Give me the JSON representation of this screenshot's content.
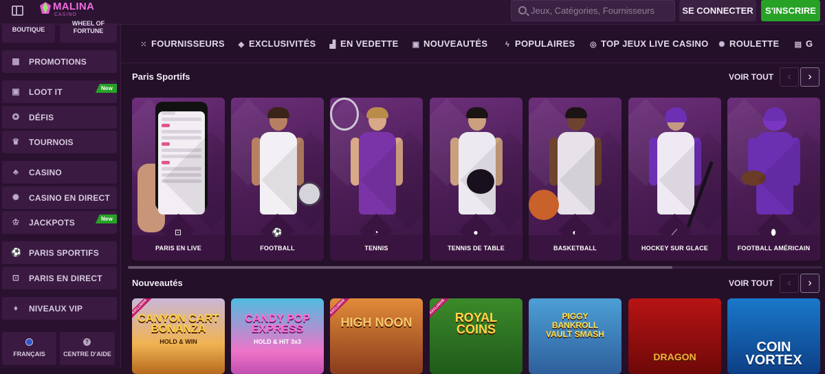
{
  "header": {
    "logo_text": "MALINA",
    "logo_sub": "CASINO",
    "search_placeholder": "Jeux, Catégories, Fournisseurs",
    "login_label": "SE CONNECTER",
    "signup_label": "S'INSCRIRE"
  },
  "sidebar": {
    "top_items": [
      {
        "label": "BOUTIQUE"
      },
      {
        "label": "WHEEL OF FORTUNE"
      }
    ],
    "items": [
      {
        "label": "PROMOTIONS",
        "icon": "gift-icon"
      },
      {
        "label": "LOOT IT",
        "icon": "loot-box-icon",
        "badge": "New"
      },
      {
        "label": "DÉFIS",
        "icon": "medal-icon"
      },
      {
        "label": "TOURNOIS",
        "icon": "trophy-icon"
      },
      {
        "label": "CASINO",
        "icon": "cards-icon"
      },
      {
        "label": "CASINO EN DIRECT",
        "icon": "roulette-icon"
      },
      {
        "label": "JACKPOTS",
        "icon": "jackpot-icon",
        "badge": "New"
      },
      {
        "label": "PARIS SPORTIFS",
        "icon": "soccer-ball-icon"
      },
      {
        "label": "PARIS EN DIRECT",
        "icon": "live-bet-icon"
      },
      {
        "label": "NIVEAUX VIP",
        "icon": "diamond-icon"
      }
    ],
    "language_label": "FRANÇAIS",
    "help_label": "CENTRE D'AIDE"
  },
  "categories": [
    {
      "label": "FOURNISSEURS",
      "icon": "grid-icon"
    },
    {
      "label": "EXCLUSIVITÉS",
      "icon": "diamond-icon"
    },
    {
      "label": "EN VEDETTE",
      "icon": "podium-icon"
    },
    {
      "label": "NOUVEAUTÉS",
      "icon": "new-icon"
    },
    {
      "label": "POPULAIRES",
      "icon": "bolt-icon"
    },
    {
      "label": "TOP JEUX LIVE CASINO",
      "icon": "chip-icon"
    },
    {
      "label": "ROULETTE",
      "icon": "roulette-icon"
    },
    {
      "label": "G",
      "icon": "game-icon"
    }
  ],
  "sports": {
    "title": "Paris Sportifs",
    "see_all": "VOIR TOUT",
    "items": [
      {
        "label": "PARIS EN LIVE",
        "icon": "live-icon"
      },
      {
        "label": "FOOTBALL",
        "icon": "soccer-ball-icon"
      },
      {
        "label": "TENNIS",
        "icon": "tennis-ball-icon"
      },
      {
        "label": "TENNIS DE TABLE",
        "icon": "ping-pong-icon"
      },
      {
        "label": "BASKETBALL",
        "icon": "basketball-icon"
      },
      {
        "label": "HOCKEY SUR GLACE",
        "icon": "hockey-stick-icon"
      },
      {
        "label": "FOOTBALL AMÉRICAIN",
        "icon": "american-football-icon"
      }
    ]
  },
  "news": {
    "title": "Nouveautés",
    "see_all": "VOIR TOUT",
    "games": [
      {
        "title": "CANYON CART BONANZA",
        "subtitle": "HOLD & WIN",
        "exclusive": "EXCLUSIVE"
      },
      {
        "title": "CANDY POP EXPRESS",
        "subtitle": "HOLD & HIT 3x3",
        "exclusive": ""
      },
      {
        "title": "HIGH NOON",
        "subtitle": "",
        "exclusive": "EXCLUSIVE"
      },
      {
        "title": "ROYAL COINS",
        "subtitle": "",
        "exclusive": "EXCLUSIVE"
      },
      {
        "title": "PIGGY BANKROLL VAULT SMASH",
        "subtitle": "",
        "exclusive": ""
      },
      {
        "title": "DRAGON",
        "subtitle": "",
        "exclusive": ""
      },
      {
        "title": "COIN VORTEX",
        "subtitle": "",
        "exclusive": ""
      }
    ]
  },
  "colors": {
    "background": "#241029",
    "card": "#4b1d55",
    "signup_green": "#27a227",
    "logo_pink": "#f06de0"
  }
}
